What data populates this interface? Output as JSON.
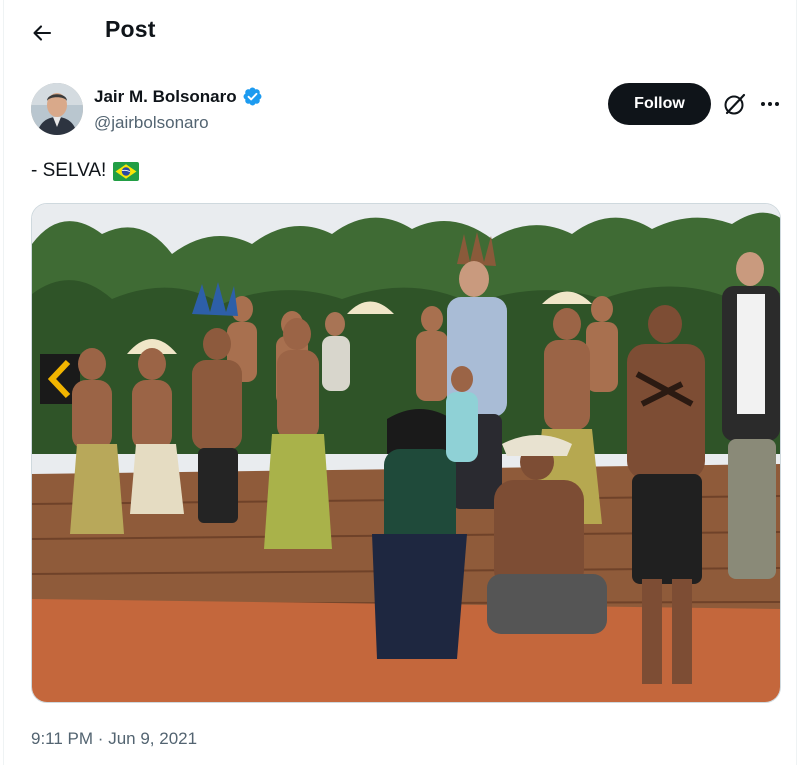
{
  "header": {
    "title": "Post"
  },
  "author": {
    "name": "Jair M. Bolsonaro",
    "handle": "@jairbolsonaro",
    "verified": true
  },
  "actions": {
    "follow_label": "Follow"
  },
  "tweet": {
    "text": "- SELVA!",
    "emoji": "brazil-flag"
  },
  "media": {
    "alt": ""
  },
  "meta": {
    "time": "9:11 PM",
    "separator": "·",
    "date": "Jun 9, 2021"
  },
  "colors": {
    "verified_blue": "#1d9bf0",
    "follow_bg": "#0f1419",
    "muted": "#536471"
  }
}
